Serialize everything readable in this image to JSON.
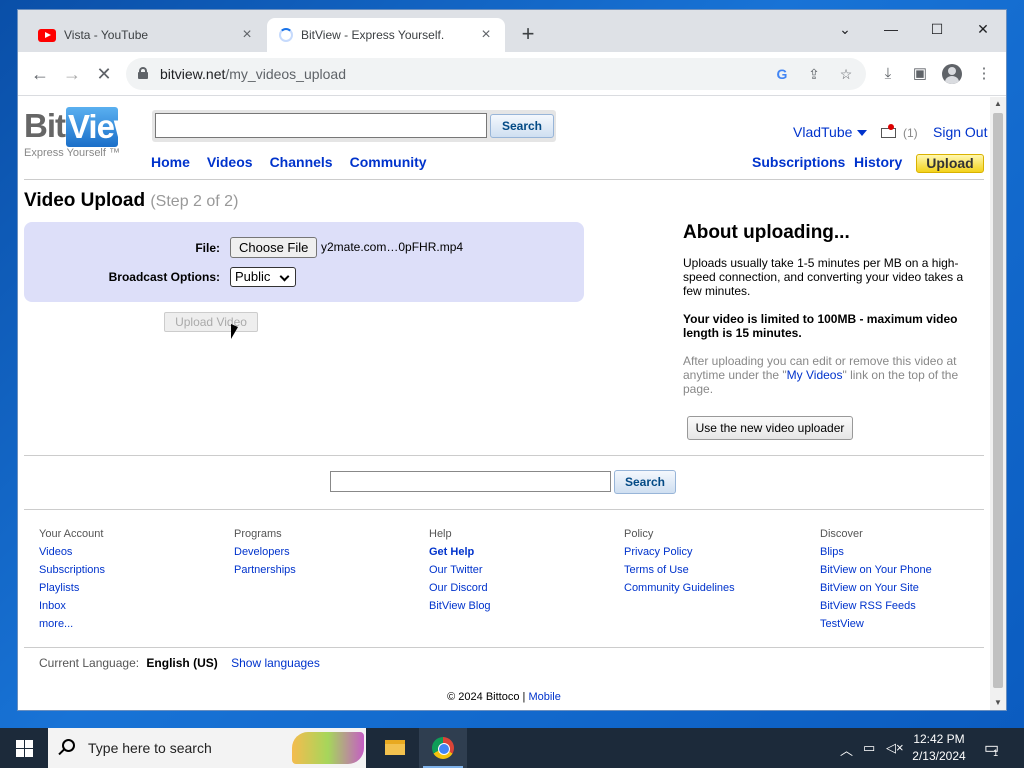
{
  "browser": {
    "tabs": [
      {
        "title": "Vista - YouTube",
        "icon": "youtube-icon"
      },
      {
        "title": "BitView - Express Yourself.",
        "icon": "loading-spinner-icon"
      }
    ],
    "new_tab": "+",
    "url_host": "bitview.net",
    "url_path": "/my_videos_upload"
  },
  "site": {
    "logo_bit": "Bit",
    "logo_view": "View",
    "tagline": "Express Yourself ™",
    "search_button": "Search",
    "nav": [
      "Home",
      "Videos",
      "Channels",
      "Community"
    ],
    "user": "VladTube",
    "inbox_count": "(1)",
    "sign_out": "Sign Out",
    "subnav": [
      "Subscriptions",
      "History"
    ],
    "upload": "Upload"
  },
  "upload": {
    "title": "Video Upload",
    "step": "(Step 2 of 2)",
    "file_label": "File:",
    "choose_file": "Choose File",
    "file_name": "y2mate.com…0pFHR.mp4",
    "broadcast_label": "Broadcast Options:",
    "broadcast_value": "Public",
    "upload_button": "Upload Video"
  },
  "about": {
    "heading": "About uploading...",
    "p1": "Uploads usually take 1-5 minutes per MB on a high-speed connection, and converting your video takes a few minutes.",
    "p2": "Your video is limited to 100MB - maximum video length is 15 minutes.",
    "p3_pre": "After uploading you can edit or remove this video at anytime under the \"",
    "p3_link": "My Videos",
    "p3_post": "\" link on the top of the page.",
    "new_uploader": "Use the new video uploader"
  },
  "bottom_search_button": "Search",
  "footer": {
    "columns": [
      {
        "head": "Your Account",
        "links": [
          "Videos",
          "Subscriptions",
          "Playlists",
          "Inbox",
          "more..."
        ]
      },
      {
        "head": "Programs",
        "links": [
          "Developers",
          "Partnerships"
        ]
      },
      {
        "head": "Help",
        "links": [
          "Get Help",
          "Our Twitter",
          "Our Discord",
          "BitView Blog"
        ]
      },
      {
        "head": "Policy",
        "links": [
          "Privacy Policy",
          "Terms of Use",
          "Community Guidelines"
        ]
      },
      {
        "head": "Discover",
        "links": [
          "Blips",
          "BitView on Your Phone",
          "BitView on Your Site",
          "BitView RSS Feeds",
          "TestView"
        ]
      }
    ],
    "language_label": "Current Language:",
    "language_value": "English (US)",
    "show_languages": "Show languages",
    "copyright": "© 2024 Bittoco | ",
    "mobile": "Mobile"
  },
  "taskbar": {
    "search_placeholder": "Type here to search",
    "time": "12:42 PM",
    "date": "2/13/2024",
    "notification_count": "1"
  }
}
